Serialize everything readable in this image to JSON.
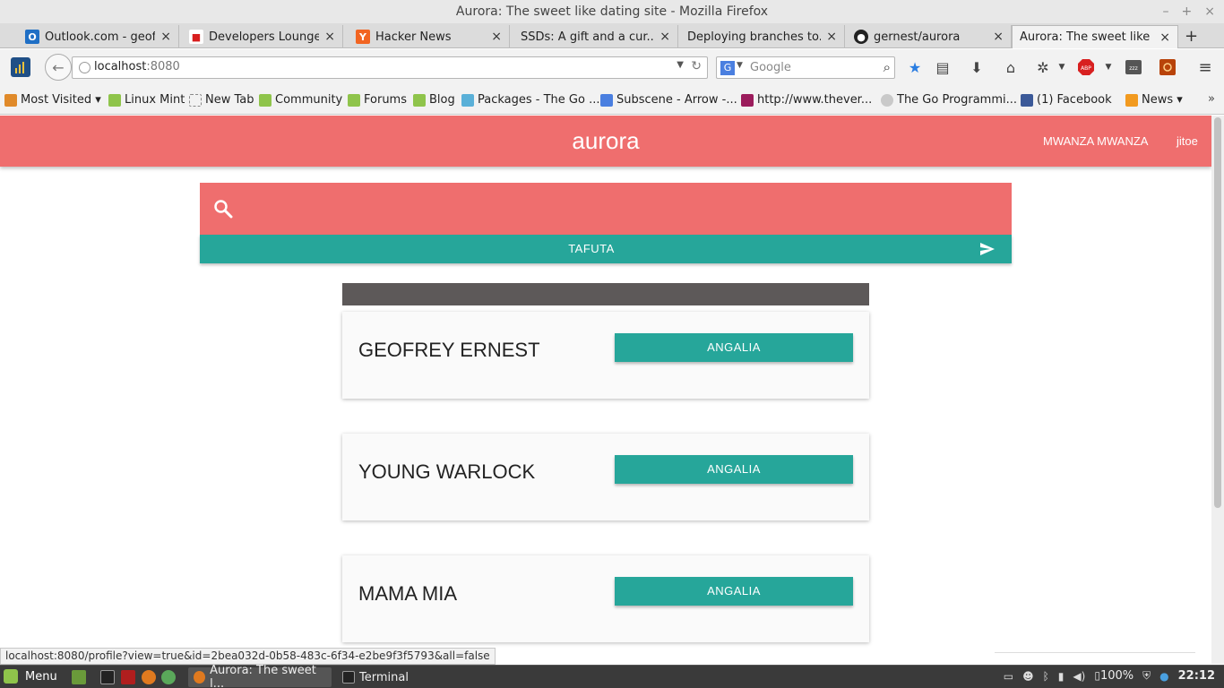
{
  "window": {
    "title": "Aurora: The sweet like dating site - Mozilla Firefox",
    "minimize": "–",
    "maximize": "+",
    "close": "×"
  },
  "tabs": [
    {
      "label": "Outlook.com - geof...",
      "icon": "outlook-icon",
      "color": "#1f6fc5",
      "glyph": "O"
    },
    {
      "label": "Developers Lounge...",
      "icon": "developers-lounge-icon",
      "color": "#d81e1e",
      "glyph": "■"
    },
    {
      "label": "Hacker News",
      "icon": "hacker-news-icon",
      "color": "#f26522",
      "glyph": "Y"
    },
    {
      "label": "SSDs: A gift and a cur...",
      "icon": "",
      "color": "",
      "glyph": ""
    },
    {
      "label": "Deploying branches to...",
      "icon": "",
      "color": "",
      "glyph": ""
    },
    {
      "label": "gernest/aurora",
      "icon": "github-icon",
      "color": "#222222",
      "glyph": "●"
    },
    {
      "label": "Aurora: The sweet like ...",
      "icon": "",
      "color": "",
      "glyph": ""
    }
  ],
  "tab_close": "×",
  "new_tab": "+",
  "navbar": {
    "url_host": "localhost",
    "url_port": ":8080",
    "search_placeholder": "Google",
    "search_engine_glyph": "G"
  },
  "bookmarks": [
    {
      "label": "Most Visited ▾",
      "color": "#e08a2a"
    },
    {
      "label": "Linux Mint",
      "color": "#8fc44b"
    },
    {
      "label": "New Tab",
      "color": "#ffffff"
    },
    {
      "label": "Community",
      "color": "#8fc44b"
    },
    {
      "label": "Forums",
      "color": "#8fc44b"
    },
    {
      "label": "Blog",
      "color": "#8fc44b"
    },
    {
      "label": "Packages - The Go ...",
      "color": "#5ab0d8"
    },
    {
      "label": "Subscene - Arrow -...",
      "color": "#4a7fe0"
    },
    {
      "label": "http://www.thever...",
      "color": "#9b1c5c"
    },
    {
      "label": "The Go Programmi...",
      "color": "#c9c9c9"
    },
    {
      "label": "(1) Facebook",
      "color": "#3b5998"
    },
    {
      "label": "News ▾",
      "color": "#f29a1f"
    }
  ],
  "bookmarks_more": "»",
  "app": {
    "title": "aurora",
    "nav_links": [
      "MWANZA MWANZA",
      "jitoe"
    ],
    "search_value": "",
    "search_button_label": "TAFUTA",
    "accent_color": "#ef6e6e",
    "button_color": "#26a69a",
    "profiles": [
      {
        "name": "GEOFREY ERNEST",
        "action": "ANGALIA"
      },
      {
        "name": "YOUNG WARLOCK",
        "action": "ANGALIA"
      },
      {
        "name": "MAMA MIA",
        "action": "ANGALIA"
      }
    ]
  },
  "status_link": "localhost:8080/profile?view=true&id=2bea032d-0b58-483c-6f34-e2be9f3f5793&all=false",
  "taskbar": {
    "menu_label": "Menu",
    "tasks": [
      {
        "label": "Aurora: The sweet l...",
        "active": true
      },
      {
        "label": "Terminal",
        "active": false
      }
    ],
    "battery": "100%",
    "clock": "22:12"
  }
}
